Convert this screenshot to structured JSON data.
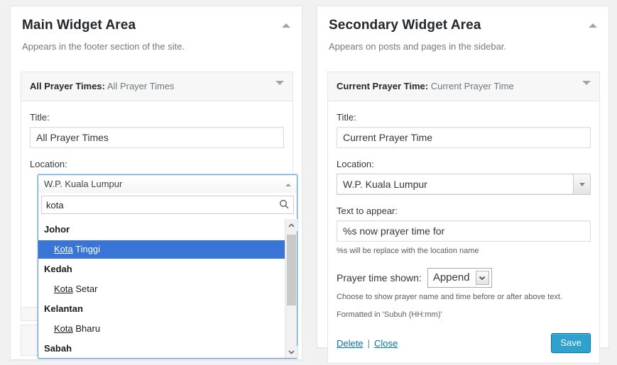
{
  "main_panel": {
    "title": "Main Widget Area",
    "description": "Appears in the footer section of the site.",
    "toggle_icon": "chevron-up-icon",
    "widget": {
      "name": "All Prayer Times:",
      "title": "All Prayer Times",
      "bar_icon": "chevron-down-icon",
      "title_label": "Title:",
      "title_value": "All Prayer Times",
      "location_label": "Location:"
    }
  },
  "location_dropdown": {
    "selected": "W.P. Kuala Lumpur",
    "toggle_icon": "chevron-up-icon",
    "search_value": "kota",
    "search_icon": "search-icon",
    "scroll_up_icon": "chevron-up-icon",
    "scroll_down_icon": "chevron-down-icon",
    "groups": [
      {
        "label": "Johor",
        "options": [
          {
            "match": "Kota",
            "rest": " Tinggi",
            "selected": true
          }
        ]
      },
      {
        "label": "Kedah",
        "options": [
          {
            "match": "Kota",
            "rest": " Setar",
            "selected": false
          }
        ]
      },
      {
        "label": "Kelantan",
        "options": [
          {
            "match": "Kota",
            "rest": " Bharu",
            "selected": false
          }
        ]
      },
      {
        "label": "Sabah",
        "options": []
      }
    ]
  },
  "secondary_panel": {
    "title": "Secondary Widget Area",
    "description": "Appears on posts and pages in the sidebar.",
    "toggle_icon": "chevron-up-icon",
    "widget": {
      "name": "Current Prayer Time:",
      "title": "Current Prayer Time",
      "bar_icon": "chevron-down-icon",
      "title_label": "Title:",
      "title_value": "Current Prayer Time",
      "location_label": "Location:",
      "location_value": "W.P. Kuala Lumpur",
      "location_icon": "chevron-down-icon",
      "text_label": "Text to appear:",
      "text_value": "%s now prayer time for",
      "text_hint": "%s will be replace with the location name",
      "prayer_time_label": "Prayer time shown:",
      "prayer_time_value": "Append",
      "prayer_time_icon": "chevron-down-icon",
      "prayer_time_hint": "Choose to show prayer name and time before or after above text.",
      "format_hint": "Formatted in 'Subuh (HH:mm)'",
      "delete_label": "Delete",
      "separator": "|",
      "close_label": "Close",
      "save_label": "Save"
    }
  },
  "colors": {
    "page_bg": "#f1f1f1",
    "panel_bg": "#ffffff",
    "border": "#e5e5e5",
    "highlight_blue": "#3875d7",
    "focus_blue": "#5b9dd9",
    "link_blue": "#0073aa",
    "button_blue": "#2ea2cc"
  }
}
